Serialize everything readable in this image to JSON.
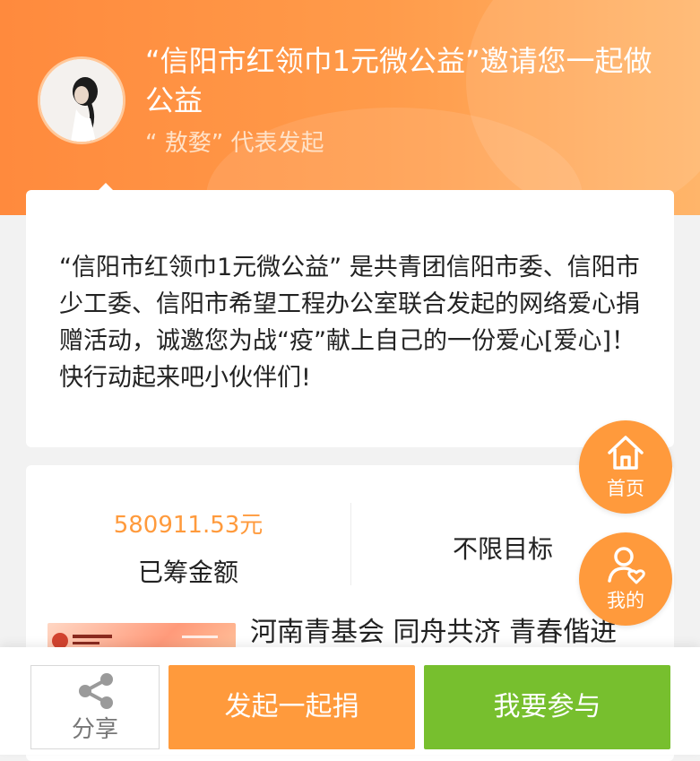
{
  "header": {
    "title": "“信阳市红领巾1元微公益”邀请您一起做公益",
    "subtitle": "“ 敖婺” 代表发起"
  },
  "description": {
    "text": "“信阳市红领巾1元微公益” 是共青团信阳市委、信阳市少工委、信阳市希望工程办公室联合发起的网络爱心捐赠活动，诚邀您为战“疫”献上自己的一份爱心[爱心]！ 快行动起来吧小伙伴们!"
  },
  "stats": {
    "amount": "580911.53元",
    "amount_label": "已筹金额",
    "target": "不限目标"
  },
  "project": {
    "title": "河南青基会 同舟共济 青春偕进"
  },
  "floating": {
    "home_label": "首页",
    "mine_label": "我的"
  },
  "bottom_bar": {
    "share_label": "分享",
    "start_label": "发起一起捐",
    "join_label": "我要参与"
  },
  "colors": {
    "brand_orange": "#ff9a3c",
    "action_green": "#77bf2e"
  }
}
